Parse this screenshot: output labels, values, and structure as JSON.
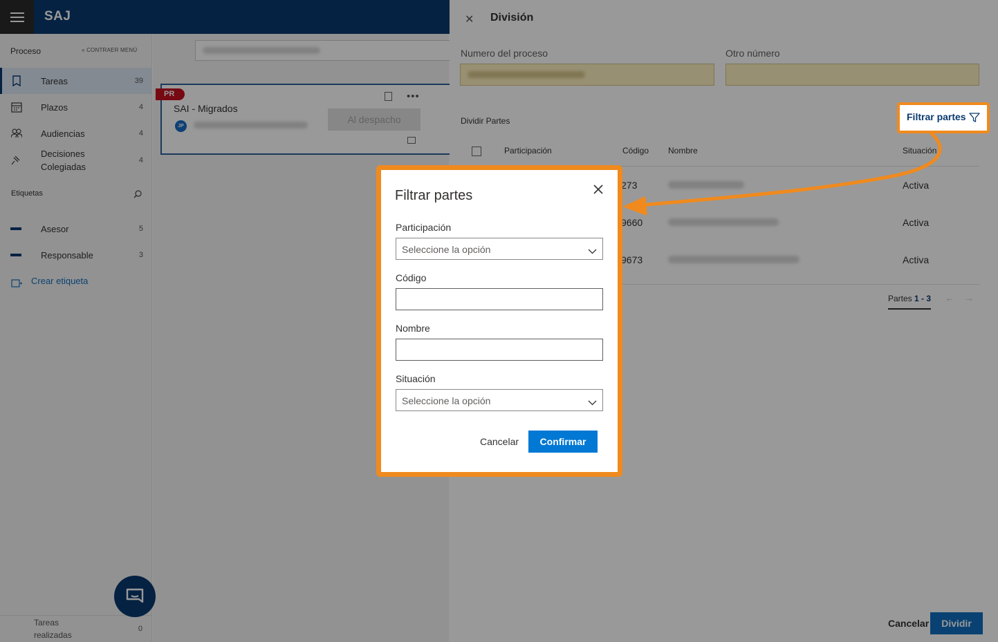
{
  "app": {
    "title": "SAJ"
  },
  "sidebar": {
    "heading": "Proceso",
    "collapse_label": "« CONTRAER MENÚ",
    "items": [
      {
        "label": "Tareas",
        "count": "39",
        "icon": "book-icon"
      },
      {
        "label": "Plazos",
        "count": "4",
        "icon": "calendar-icon"
      },
      {
        "label": "Audiencias",
        "count": "4",
        "icon": "people-icon"
      },
      {
        "label": "Decisiones Colegiadas",
        "count": "4",
        "icon": "gavel-icon"
      }
    ],
    "tags_heading": "Etiquetas",
    "tags": [
      {
        "label": "Asesor",
        "count": "5"
      },
      {
        "label": "Responsable",
        "count": "3"
      }
    ],
    "create_tag": "Crear etiqueta",
    "footer": {
      "label": "Tareas realizadas",
      "count": "0"
    }
  },
  "card": {
    "badge": "PR",
    "title": "SAI - Migrados",
    "avatar": "JP",
    "action": "Al despacho"
  },
  "panel": {
    "title": "División",
    "field1_label": "Numero del proceso",
    "field2_label": "Otro número",
    "section": "Dividir Partes",
    "filter_link": "Filtrar partes",
    "columns": [
      "Participación",
      "Código",
      "Nombre",
      "Situación"
    ],
    "rows": [
      {
        "code": "273",
        "status": "Activa"
      },
      {
        "code": "9660",
        "status": "Activa"
      },
      {
        "code": "9673",
        "status": "Activa"
      }
    ],
    "pagination_prefix": "Partes",
    "pagination_range": "1 - 3",
    "cancel": "Cancelar",
    "submit": "Dividir"
  },
  "dialog": {
    "title": "Filtrar partes",
    "participacion_label": "Participación",
    "participacion_placeholder": "Seleccione la opción",
    "codigo_label": "Código",
    "codigo_value": "",
    "nombre_label": "Nombre",
    "nombre_value": "",
    "situacion_label": "Situación",
    "situacion_placeholder": "Seleccione la opción",
    "cancel": "Cancelar",
    "confirm": "Confirmar"
  },
  "colors": {
    "topbar": "#0b3a6e",
    "highlight": "#f08a1e",
    "primary": "#0078d4"
  }
}
